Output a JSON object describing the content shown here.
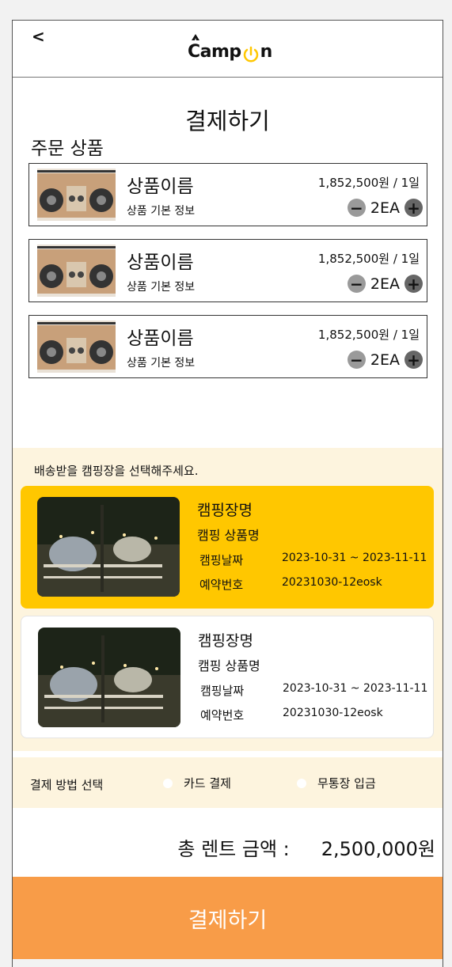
{
  "header": {
    "back_label": "<",
    "logo_text_a": "Camp",
    "logo_text_b": "n"
  },
  "page": {
    "title": "결제하기",
    "section_label": "주문 상품"
  },
  "products": [
    {
      "name": "상품이름",
      "info": "상품 기본 정보",
      "price": "1,852,500원 / 1일",
      "qty": "2EA"
    },
    {
      "name": "상품이름",
      "info": "상품 기본 정보",
      "price": "1,852,500원 / 1일",
      "qty": "2EA"
    },
    {
      "name": "상품이름",
      "info": "상품 기본 정보",
      "price": "1,852,500원 / 1일",
      "qty": "2EA"
    }
  ],
  "camp": {
    "prompt": "배송받을 캠핑장을 선택해주세요.",
    "cards": [
      {
        "name": "캠핑장명",
        "product": "캠핑 상품명",
        "date_label": "캠핑날짜",
        "date": "2023-10-31 ~ 2023-11-11",
        "res_label": "예약번호",
        "res": "20231030-12eosk",
        "selected": true
      },
      {
        "name": "캠핑장명",
        "product": "캠핑 상품명",
        "date_label": "캠핑날짜",
        "date": "2023-10-31 ~ 2023-11-11",
        "res_label": "예약번호",
        "res": "20231030-12eosk",
        "selected": false
      }
    ]
  },
  "payment": {
    "label": "결제 방법 선택",
    "options": [
      "카드 결제",
      "무통장 입금"
    ]
  },
  "total": {
    "label": "총 렌트 금액 :",
    "amount": "2,500,000원"
  },
  "submit_label": "결제하기",
  "colors": {
    "accent": "#ffc700",
    "submit": "#f89c48",
    "section_bg": "#fdf4de"
  }
}
